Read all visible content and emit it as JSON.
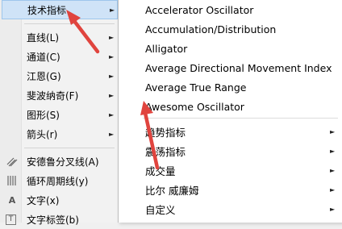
{
  "left_menu": {
    "items": [
      {
        "label": "技术指标",
        "has_submenu": true
      },
      {
        "label": "直线(L)",
        "has_submenu": true
      },
      {
        "label": "通道(C)",
        "has_submenu": true
      },
      {
        "label": "江恩(G)",
        "has_submenu": true
      },
      {
        "label": "斐波纳奇(F)",
        "has_submenu": true
      },
      {
        "label": "图形(S)",
        "has_submenu": true
      },
      {
        "label": "箭头(r)",
        "has_submenu": true
      },
      {
        "label": "安德鲁分叉线(A)",
        "icon": "andrews-pitchfork-icon"
      },
      {
        "label": "循环周期线(y)",
        "icon": "cycle-lines-icon"
      },
      {
        "label": "文字(x)",
        "icon": "text-icon",
        "icon_glyph": "A"
      },
      {
        "label": "文字标签(b)",
        "icon": "text-label-icon",
        "icon_glyph": "T"
      }
    ]
  },
  "submenu": {
    "items": [
      {
        "label": "Accelerator Oscillator"
      },
      {
        "label": "Accumulation/Distribution"
      },
      {
        "label": "Alligator"
      },
      {
        "label": "Average Directional Movement Index"
      },
      {
        "label": "Average True Range"
      },
      {
        "label": "Awesome Oscillator"
      },
      {
        "label": "趋势指标",
        "has_submenu": true
      },
      {
        "label": "震荡指标",
        "has_submenu": true
      },
      {
        "label": "成交量",
        "has_submenu": true
      },
      {
        "label": "比尔 威廉姆",
        "has_submenu": true
      },
      {
        "label": "自定义",
        "has_submenu": true
      }
    ]
  },
  "arrow_glyph": "►",
  "annotation_color": "#e0443e",
  "highlight_color": "#cfe3f7"
}
